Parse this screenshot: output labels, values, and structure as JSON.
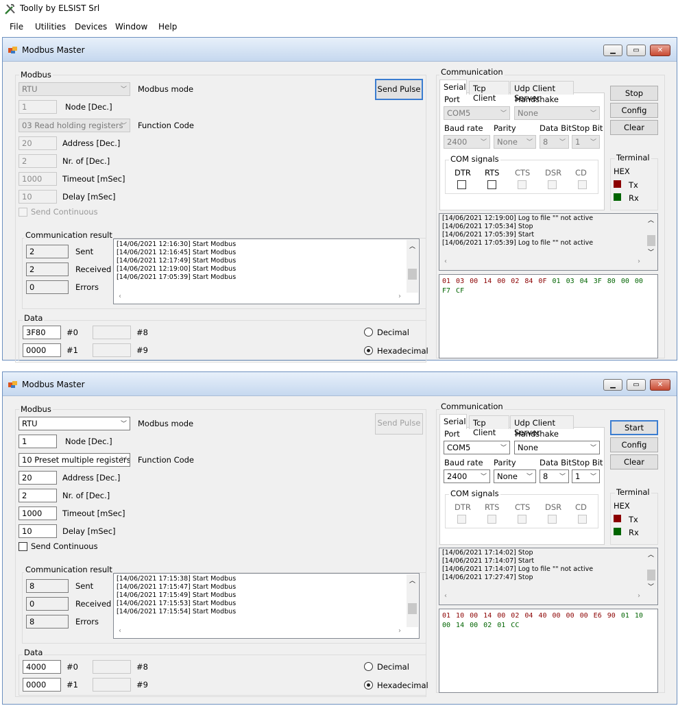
{
  "app": {
    "title": "Toolly by ELSIST Srl",
    "menu": [
      "File",
      "Utilities",
      "Devices",
      "Window",
      "Help"
    ]
  },
  "colors": {
    "tx": "#8b0000",
    "rx": "#006400"
  },
  "windows": [
    {
      "title": "Modbus Master",
      "modbus": {
        "group": "Modbus",
        "mode": "RTU",
        "mode_label": "Modbus mode",
        "node": "1",
        "node_label": "Node [Dec.]",
        "function": "03 Read holding registers",
        "function_label": "Function Code",
        "address": "20",
        "address_label": "Address [Dec.]",
        "nr": "2",
        "nr_label": "Nr. of [Dec.]",
        "timeout": "1000",
        "timeout_label": "Timeout [mSec]",
        "delay": "10",
        "delay_label": "Delay [mSec]",
        "send_continuous": "Send Continuous",
        "send_pulse": "Send Pulse"
      },
      "result": {
        "group": "Communication result",
        "sent": "2",
        "sent_label": "Sent",
        "received": "2",
        "received_label": "Received",
        "errors": "0",
        "errors_label": "Errors",
        "log": [
          "[14/06/2021 12:16:30] Start Modbus",
          "[14/06/2021 12:16:45] Start Modbus",
          "[14/06/2021 12:17:49] Start Modbus",
          "[14/06/2021 12:19:00] Start Modbus",
          "[14/06/2021 17:05:39] Start Modbus"
        ]
      },
      "data": {
        "group": "Data",
        "d0": "3F80",
        "d0_label": "#0",
        "d1": "0000",
        "d1_label": "#1",
        "d8": "",
        "d8_label": "#8",
        "d9": "",
        "d9_label": "#9",
        "decimal": "Decimal",
        "hexadecimal": "Hexadecimal",
        "selected": "Hexadecimal"
      },
      "comm": {
        "group": "Communication",
        "tabs": [
          "Serial",
          "Tcp Client",
          "Udp Client Server"
        ],
        "port_label": "Port",
        "port": "COM5",
        "handshake_label": "Handshake",
        "handshake": "None",
        "baud_label": "Baud rate",
        "baud": "2400",
        "parity_label": "Parity",
        "parity": "None",
        "databit_label": "Data Bit",
        "databit": "8",
        "stopbit_label": "Stop Bit",
        "stopbit": "1",
        "signals_group": "COM signals",
        "signals": [
          "DTR",
          "RTS",
          "CTS",
          "DSR",
          "CD"
        ],
        "action_button": "Stop",
        "config_button": "Config",
        "clear_button": "Clear",
        "terminal_group": "Terminal",
        "terminal_mode": "HEX",
        "tx_label": "Tx",
        "rx_label": "Rx",
        "log": [
          "[14/06/2021 12:19:00] Log to file \"\" not active",
          "[14/06/2021 17:05:34] Stop",
          "[14/06/2021 17:05:39] Start",
          "[14/06/2021 17:05:39] Log to file \"\" not active"
        ],
        "hex_tx": "01 03 00 14 00 02 84 0F",
        "hex_rx": "01 03 04 3F 80 00 00 F7 CF"
      }
    },
    {
      "title": "Modbus Master",
      "modbus": {
        "group": "Modbus",
        "mode": "RTU",
        "mode_label": "Modbus mode",
        "node": "1",
        "node_label": "Node [Dec.]",
        "function": "10 Preset multiple registers",
        "function_label": "Function Code",
        "address": "20",
        "address_label": "Address [Dec.]",
        "nr": "2",
        "nr_label": "Nr. of [Dec.]",
        "timeout": "1000",
        "timeout_label": "Timeout [mSec]",
        "delay": "10",
        "delay_label": "Delay [mSec]",
        "send_continuous": "Send Continuous",
        "send_pulse": "Send Pulse"
      },
      "result": {
        "group": "Communication result",
        "sent": "8",
        "sent_label": "Sent",
        "received": "0",
        "received_label": "Received",
        "errors": "8",
        "errors_label": "Errors",
        "log": [
          "[14/06/2021 17:15:38] Start Modbus",
          "[14/06/2021 17:15:47] Start Modbus",
          "[14/06/2021 17:15:49] Start Modbus",
          "[14/06/2021 17:15:53] Start Modbus",
          "[14/06/2021 17:15:54] Start Modbus"
        ]
      },
      "data": {
        "group": "Data",
        "d0": "4000",
        "d0_label": "#0",
        "d1": "0000",
        "d1_label": "#1",
        "d8": "",
        "d8_label": "#8",
        "d9": "",
        "d9_label": "#9",
        "decimal": "Decimal",
        "hexadecimal": "Hexadecimal",
        "selected": "Hexadecimal"
      },
      "comm": {
        "group": "Communication",
        "tabs": [
          "Serial",
          "Tcp Client",
          "Udp Client Server"
        ],
        "port_label": "Port",
        "port": "COM5",
        "handshake_label": "Handshake",
        "handshake": "None",
        "baud_label": "Baud rate",
        "baud": "2400",
        "parity_label": "Parity",
        "parity": "None",
        "databit_label": "Data Bit",
        "databit": "8",
        "stopbit_label": "Stop Bit",
        "stopbit": "1",
        "signals_group": "COM signals",
        "signals": [
          "DTR",
          "RTS",
          "CTS",
          "DSR",
          "CD"
        ],
        "action_button": "Start",
        "config_button": "Config",
        "clear_button": "Clear",
        "terminal_group": "Terminal",
        "terminal_mode": "HEX",
        "tx_label": "Tx",
        "rx_label": "Rx",
        "log": [
          "[14/06/2021 17:14:02] Stop",
          "[14/06/2021 17:14:07] Start",
          "[14/06/2021 17:14:07] Log to file \"\" not active",
          "[14/06/2021 17:27:47] Stop"
        ],
        "hex_tx": "01 10 00 14 00 02 04 40 00 00 00 E6 90",
        "hex_rx": "01 10 00 14 00 02 01 CC"
      }
    }
  ]
}
